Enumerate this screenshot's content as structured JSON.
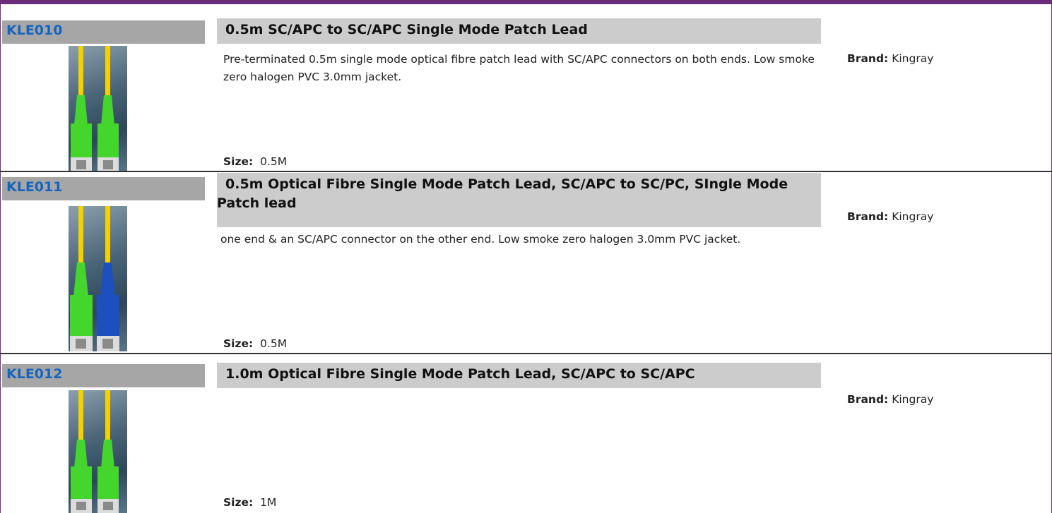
{
  "products": [
    {
      "code": "KLE010",
      "title": "0.5m SC/APC to SC/APC Single Mode Patch Lead",
      "description": "Pre-terminated 0.5m single mode optical fibre patch lead with SC/APC connectors on both ends. Low smoke zero halogen PVC 3.0mm jacket.",
      "size_label": "Size:",
      "size": "0.5M",
      "brand_label": "Brand:",
      "brand": "Kingray",
      "image_icon": "fibre-patch-lead-green-green"
    },
    {
      "code": "KLE011",
      "title": "0.5m Optical Fibre Single Mode Patch Lead, SC/APC to SC/PC, SIngle Mode Patch lead",
      "description": "one end & an SC/APC connector on the other end. Low smoke zero halogen 3.0mm PVC jacket.",
      "size_label": "Size:",
      "size": "0.5M",
      "brand_label": "Brand:",
      "brand": "Kingray",
      "image_icon": "fibre-patch-lead-green-blue"
    },
    {
      "code": "KLE012",
      "title": "1.0m Optical Fibre Single Mode Patch Lead, SC/APC to SC/APC",
      "description": "",
      "size_label": "Size:",
      "size": "1M",
      "brand_label": "Brand:",
      "brand": "Kingray",
      "image_icon": "fibre-patch-lead-green-green"
    }
  ],
  "colors": {
    "accent": "#6b2d7a",
    "code_link": "#1565c0",
    "code_bar": "#a6a6a6",
    "title_bar": "#cccccc",
    "apc_connector": "#44d62c",
    "pc_connector": "#1e4fbf",
    "fibre": "#f5d000"
  }
}
